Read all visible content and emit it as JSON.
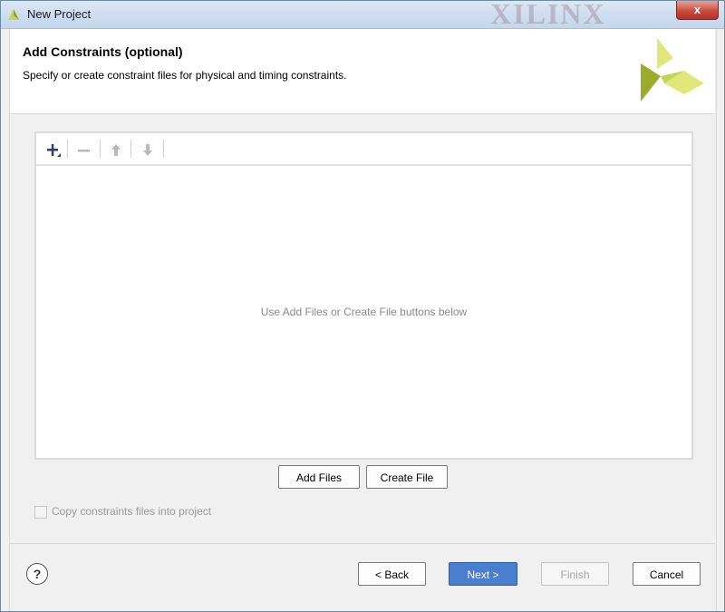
{
  "window": {
    "title": "New Project",
    "watermark": "XILINX",
    "close_label": "x"
  },
  "header": {
    "title": "Add Constraints (optional)",
    "subtitle": "Specify or create constraint files for physical and timing constraints."
  },
  "toolbar": {
    "add_icon": "plus-icon",
    "remove_icon": "minus-icon",
    "up_icon": "arrow-up-icon",
    "down_icon": "arrow-down-icon"
  },
  "panel": {
    "empty_message": "Use Add Files or Create File buttons below"
  },
  "actions": {
    "add_files": "Add Files",
    "create_file": "Create File"
  },
  "options": {
    "copy_constraints_label": "Copy constraints files into project",
    "copy_constraints_checked": false
  },
  "footer": {
    "help": "?",
    "back": "< Back",
    "next": "Next >",
    "finish": "Finish",
    "cancel": "Cancel"
  },
  "colors": {
    "accent": "#4a7fd0",
    "logo_dark": "#9bac2a",
    "logo_light": "#dfe879"
  }
}
